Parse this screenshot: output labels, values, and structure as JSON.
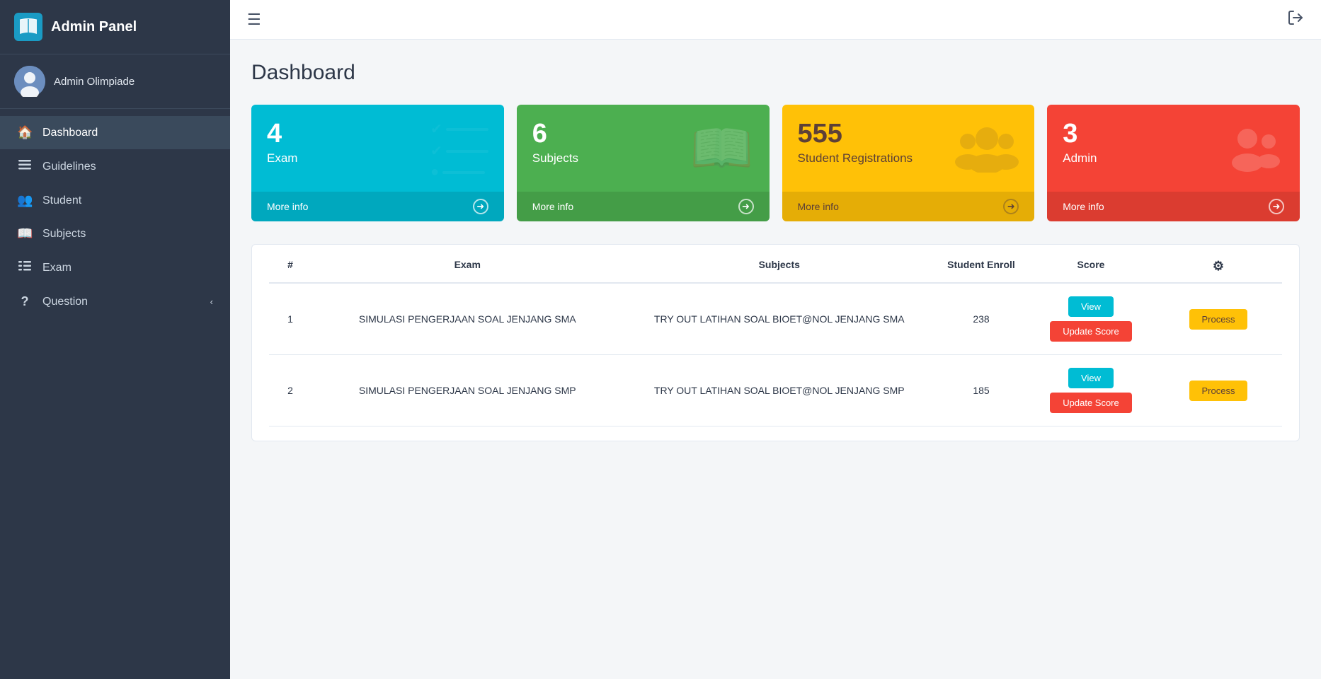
{
  "sidebar": {
    "title": "Admin Panel",
    "user": {
      "name": "Admin Olimpiade"
    },
    "nav_items": [
      {
        "id": "dashboard",
        "label": "Dashboard",
        "icon": "🏠",
        "active": true
      },
      {
        "id": "guidelines",
        "label": "Guidelines",
        "icon": "☰",
        "active": false
      },
      {
        "id": "student",
        "label": "Student",
        "icon": "👥",
        "active": false
      },
      {
        "id": "subjects",
        "label": "Subjects",
        "icon": "📖",
        "active": false
      },
      {
        "id": "exam",
        "label": "Exam",
        "icon": "☰",
        "active": false
      },
      {
        "id": "question",
        "label": "Question",
        "icon": "?",
        "active": false,
        "has_arrow": true
      }
    ]
  },
  "topbar": {
    "hamburger_label": "☰",
    "logout_label": "⇥"
  },
  "page": {
    "title": "Dashboard"
  },
  "stat_cards": [
    {
      "id": "exam",
      "number": "4",
      "label": "Exam",
      "more_info": "More info",
      "type": "cyan"
    },
    {
      "id": "subjects",
      "number": "6",
      "label": "Subjects",
      "more_info": "More info",
      "type": "green"
    },
    {
      "id": "student_registrations",
      "number": "555",
      "label": "Student Registrations",
      "more_info": "More info",
      "type": "yellow"
    },
    {
      "id": "admin",
      "number": "3",
      "label": "Admin",
      "more_info": "More info",
      "type": "red"
    }
  ],
  "table": {
    "columns": {
      "hash": "#",
      "exam": "Exam",
      "subjects": "Subjects",
      "enroll": "Student Enroll",
      "score": "Score",
      "settings": "⚙"
    },
    "rows": [
      {
        "number": "1",
        "exam": "SIMULASI PENGERJAAN SOAL JENJANG SMA",
        "subjects": "TRY OUT LATIHAN SOAL BIOET@NOL JENJANG SMA",
        "enroll": "238",
        "btn_view": "View",
        "btn_process": "Process",
        "btn_update": "Update Score"
      },
      {
        "number": "2",
        "exam": "SIMULASI PENGERJAAN SOAL JENJANG SMP",
        "subjects": "TRY OUT LATIHAN SOAL BIOET@NOL JENJANG SMP",
        "enroll": "185",
        "btn_view": "View",
        "btn_process": "Process",
        "btn_update": "Update Score"
      }
    ]
  }
}
